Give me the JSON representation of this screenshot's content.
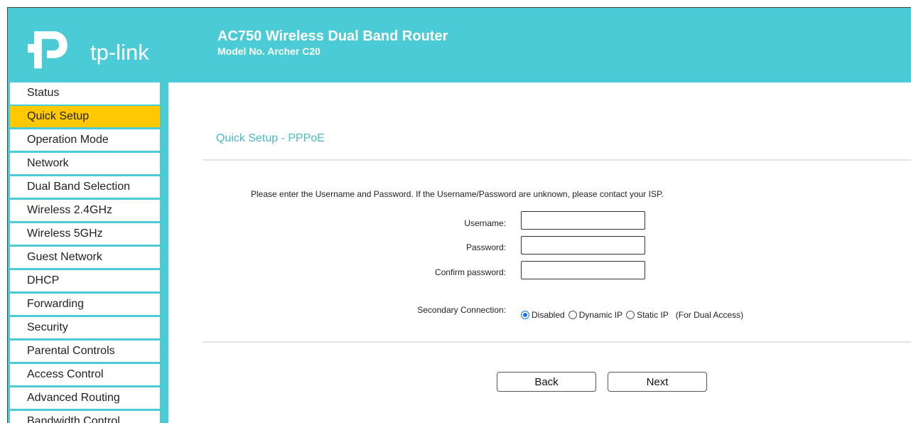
{
  "header": {
    "logo_text": "tp-link",
    "product_title": "AC750 Wireless Dual Band Router",
    "model": "Model No. Archer C20",
    "brand_color": "#4acbd6"
  },
  "sidebar": {
    "active_color": "#ffc800",
    "items": [
      {
        "label": "Status",
        "active": false
      },
      {
        "label": "Quick Setup",
        "active": true
      },
      {
        "label": "Operation Mode",
        "active": false
      },
      {
        "label": "Network",
        "active": false
      },
      {
        "label": "Dual Band Selection",
        "active": false
      },
      {
        "label": "Wireless 2.4GHz",
        "active": false
      },
      {
        "label": "Wireless 5GHz",
        "active": false
      },
      {
        "label": "Guest Network",
        "active": false
      },
      {
        "label": "DHCP",
        "active": false
      },
      {
        "label": "Forwarding",
        "active": false
      },
      {
        "label": "Security",
        "active": false
      },
      {
        "label": "Parental Controls",
        "active": false
      },
      {
        "label": "Access Control",
        "active": false
      },
      {
        "label": "Advanced Routing",
        "active": false
      },
      {
        "label": "Bandwidth Control",
        "active": false
      }
    ]
  },
  "main": {
    "page_title": "Quick Setup - PPPoE",
    "instruction": "Please enter the Username and Password. If the Username/Password are unknown, please contact your ISP.",
    "form": {
      "username_label": "Username:",
      "username_value": "",
      "password_label": "Password:",
      "password_value": "",
      "confirm_label": "Confirm password:",
      "confirm_value": "",
      "secondary_label": "Secondary Connection:",
      "options": [
        {
          "label": "Disabled",
          "checked": true
        },
        {
          "label": "Dynamic IP",
          "checked": false
        },
        {
          "label": "Static IP",
          "checked": false
        }
      ],
      "note": "(For Dual Access)"
    },
    "buttons": {
      "back": "Back",
      "next": "Next"
    }
  }
}
